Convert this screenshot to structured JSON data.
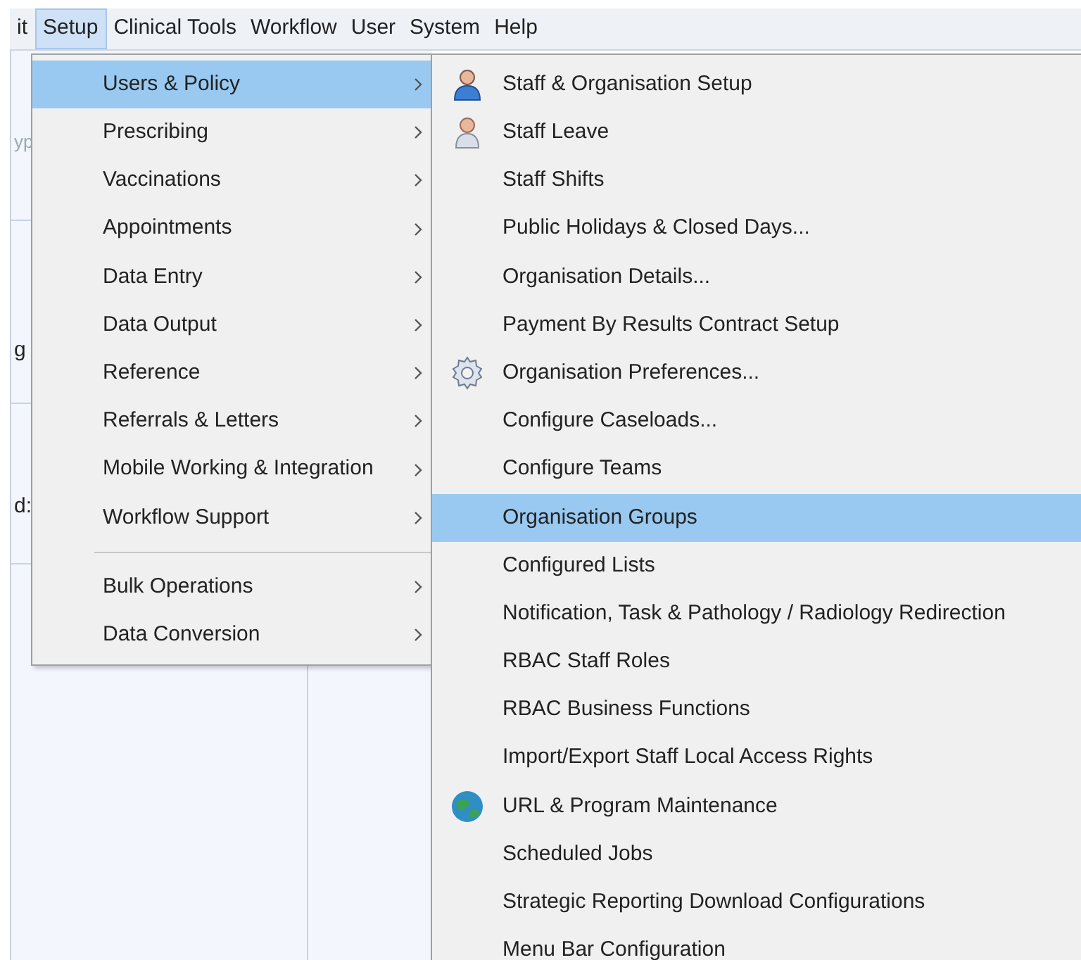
{
  "menubar": [
    {
      "label": "it",
      "selected": false
    },
    {
      "label": "Setup",
      "selected": true
    },
    {
      "label": "Clinical Tools",
      "selected": false
    },
    {
      "label": "Workflow",
      "selected": false
    },
    {
      "label": "User",
      "selected": false
    },
    {
      "label": "System",
      "selected": false
    },
    {
      "label": "Help",
      "selected": false
    }
  ],
  "background_fragments": [
    "yp",
    "g",
    "d:"
  ],
  "setup_menu": [
    {
      "items": [
        {
          "label": "Users & Policy",
          "selected": true
        },
        {
          "label": "Prescribing",
          "selected": false
        },
        {
          "label": "Vaccinations",
          "selected": false
        },
        {
          "label": "Appointments",
          "selected": false
        },
        {
          "label": "Data Entry",
          "selected": false
        },
        {
          "label": "Data Output",
          "selected": false
        },
        {
          "label": "Reference",
          "selected": false
        },
        {
          "label": "Referrals & Letters",
          "selected": false
        },
        {
          "label": "Mobile Working & Integration",
          "selected": false
        },
        {
          "label": "Workflow Support",
          "selected": false
        }
      ]
    },
    {
      "items": [
        {
          "label": "Bulk Operations",
          "selected": false
        },
        {
          "label": "Data Conversion",
          "selected": false
        }
      ]
    }
  ],
  "submenu": [
    {
      "label": "Staff & Organisation Setup",
      "selected": false,
      "kind": "person"
    },
    {
      "label": "Staff Leave",
      "selected": false,
      "kind": "person-alt"
    },
    {
      "label": "Staff Shifts",
      "selected": false,
      "kind": "plain"
    },
    {
      "label": "Public Holidays & Closed Days...",
      "selected": false,
      "kind": "plain"
    },
    {
      "label": "Organisation Details...",
      "selected": false,
      "kind": "plain"
    },
    {
      "label": "Payment By Results Contract Setup",
      "selected": false,
      "kind": "plain"
    },
    {
      "label": "Organisation Preferences...",
      "selected": false,
      "kind": "gear"
    },
    {
      "label": "Configure Caseloads...",
      "selected": false,
      "kind": "plain"
    },
    {
      "label": "Configure Teams",
      "selected": false,
      "kind": "plain"
    },
    {
      "label": "Organisation Groups",
      "selected": true,
      "kind": "plain"
    },
    {
      "label": "Configured Lists",
      "selected": false,
      "kind": "plain"
    },
    {
      "label": "Notification, Task & Pathology / Radiology Redirection",
      "selected": false,
      "kind": "plain"
    },
    {
      "label": "RBAC Staff Roles",
      "selected": false,
      "kind": "plain"
    },
    {
      "label": "RBAC Business Functions",
      "selected": false,
      "kind": "plain"
    },
    {
      "label": "Import/Export Staff Local Access Rights",
      "selected": false,
      "kind": "plain"
    },
    {
      "label": "URL & Program Maintenance",
      "selected": false,
      "kind": "globe"
    },
    {
      "label": "Scheduled Jobs",
      "selected": false,
      "kind": "plain"
    },
    {
      "label": "Strategic Reporting Download Configurations",
      "selected": false,
      "kind": "plain"
    },
    {
      "label": "Menu Bar Configuration",
      "selected": false,
      "kind": "plain"
    }
  ]
}
